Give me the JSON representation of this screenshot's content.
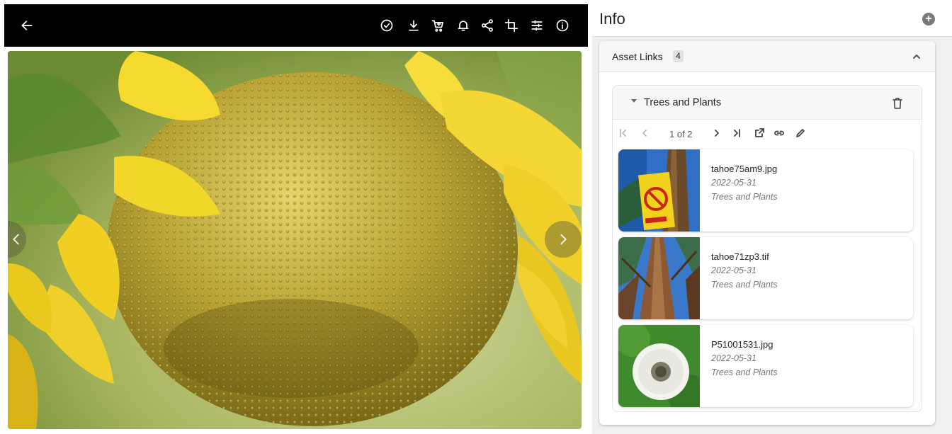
{
  "viewer": {
    "toolbar_icons": [
      "back-arrow-icon",
      "check-circle-icon",
      "download-icon",
      "cart-icon",
      "bell-icon",
      "share-icon",
      "crop-icon",
      "adjust-icon",
      "info-icon"
    ],
    "image": "sunflower-closeup"
  },
  "info": {
    "title": "Info",
    "add_label": "+"
  },
  "asset_links": {
    "label": "Asset Links",
    "count": "4",
    "group": {
      "title": "Trees and Plants",
      "pager": "1 of 2",
      "items": [
        {
          "name": "tahoe75am9.jpg",
          "date": "2022-05-31",
          "category": "Trees and Plants",
          "thumb": "no-fireworks-sign"
        },
        {
          "name": "tahoe71zp3.tif",
          "date": "2022-05-31",
          "category": "Trees and Plants",
          "thumb": "tall-pine-trees"
        },
        {
          "name": "P51001531.jpg",
          "date": "2022-05-31",
          "category": "Trees and Plants",
          "thumb": "dandelion"
        }
      ]
    }
  },
  "colors": {
    "toolbar_bg": "#000000",
    "panel_bg": "#f0f0f0",
    "accent_yellow": "#e9d34a"
  }
}
